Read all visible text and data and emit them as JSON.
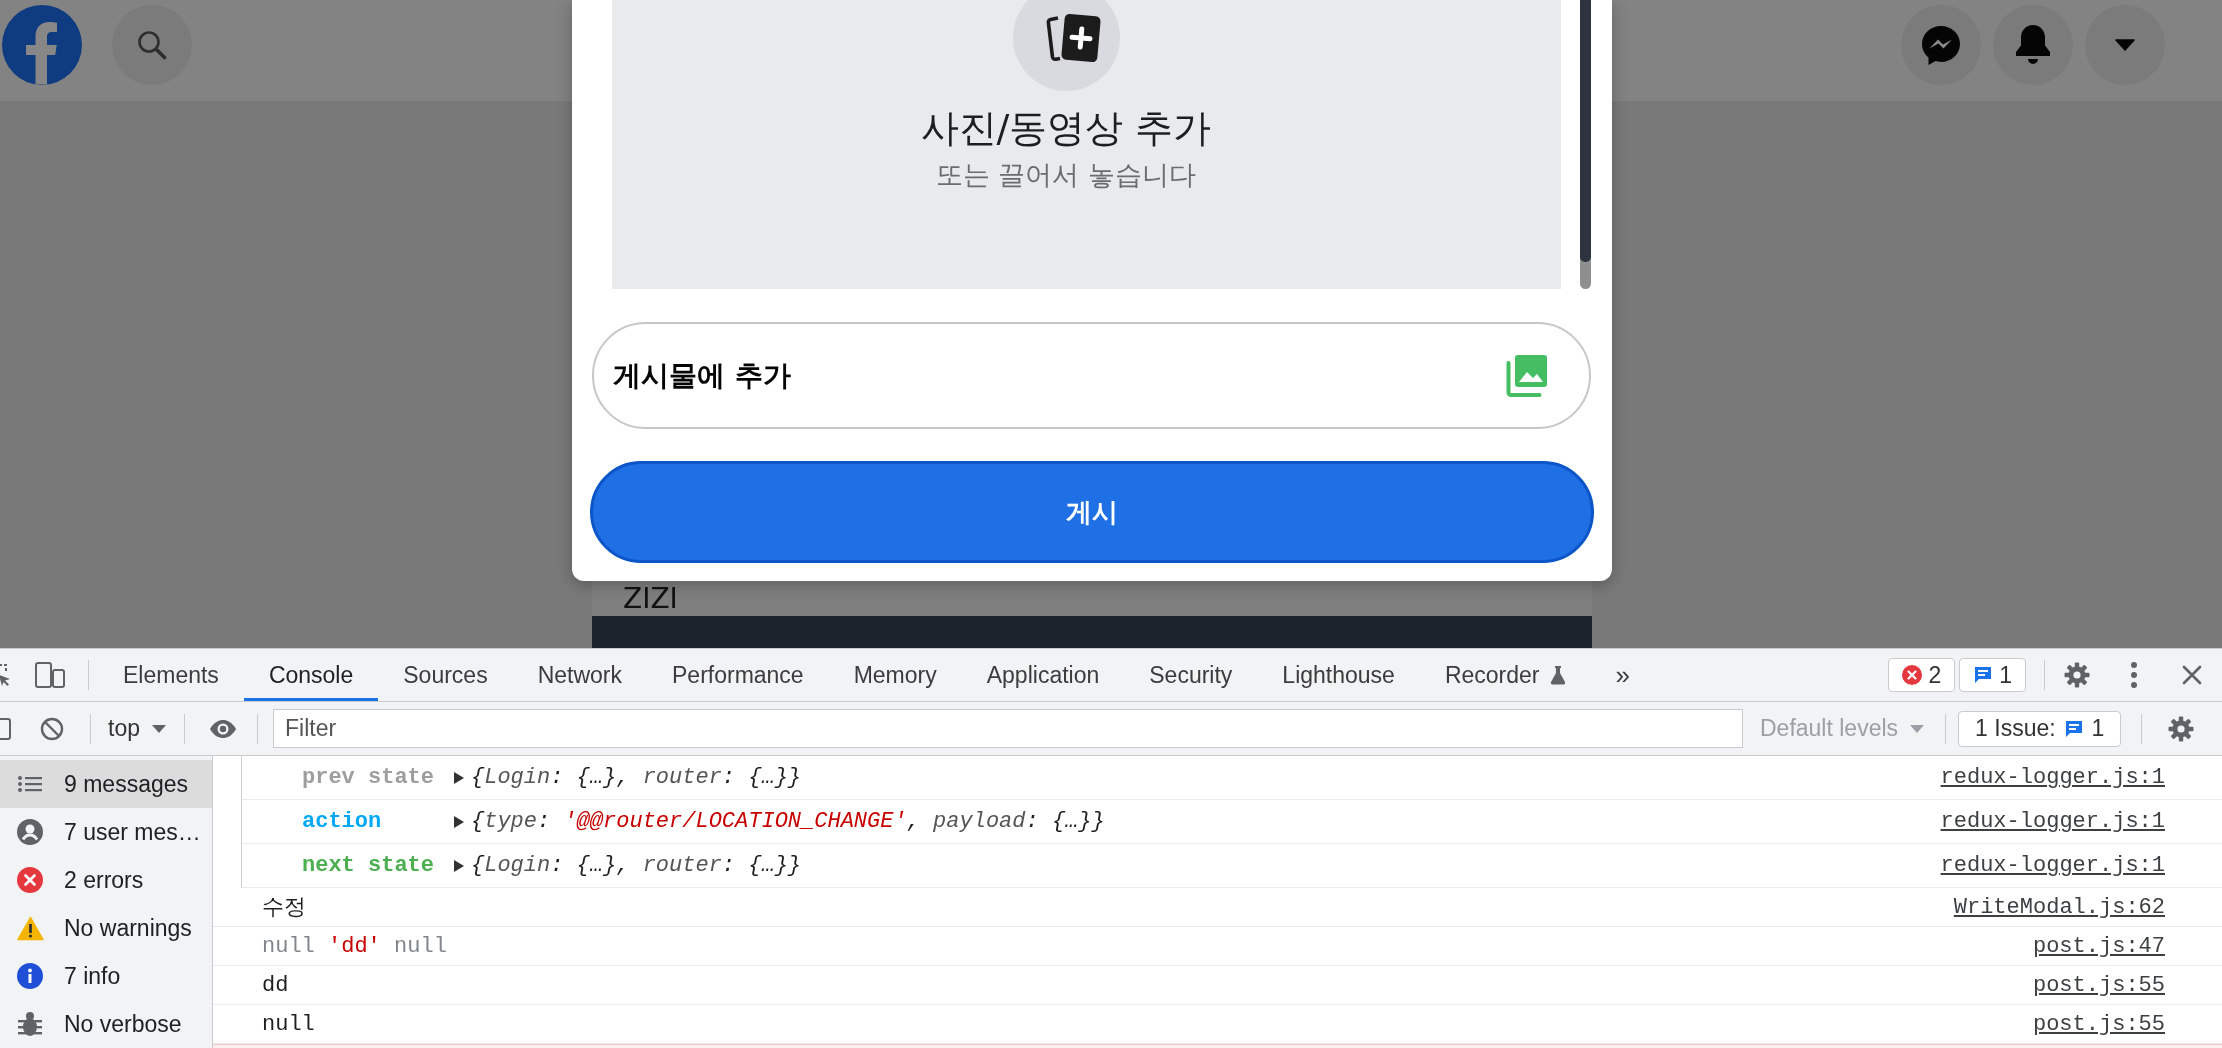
{
  "modal": {
    "upload_title": "사진/동영상 추가",
    "upload_hint": "또는 끌어서 놓습니다",
    "add_to_post": "게시물에 추가",
    "post_button": "게시"
  },
  "background_post": {
    "text": "ZIZI"
  },
  "devtools": {
    "tabs": [
      {
        "label": "Elements",
        "kind": "plain",
        "selected": false
      },
      {
        "label": "Console",
        "kind": "plain",
        "selected": true
      },
      {
        "label": "Sources",
        "kind": "plain",
        "selected": false
      },
      {
        "label": "Network",
        "kind": "plain",
        "selected": false
      },
      {
        "label": "Performance",
        "kind": "plain",
        "selected": false
      },
      {
        "label": "Memory",
        "kind": "plain",
        "selected": false
      },
      {
        "label": "Application",
        "kind": "plain",
        "selected": false
      },
      {
        "label": "Security",
        "kind": "plain",
        "selected": false
      },
      {
        "label": "Lighthouse",
        "kind": "plain",
        "selected": false
      },
      {
        "label": "Recorder",
        "kind": "experimental",
        "selected": false
      }
    ],
    "more_tabs": "»",
    "error_badge": "2",
    "message_badge": "1",
    "toolbar": {
      "context": "top",
      "filter": {
        "placeholder": "Filter"
      },
      "levels": {
        "label": "Default levels",
        "disabled": true
      },
      "issues": {
        "label": "1 Issue:",
        "count": "1"
      }
    },
    "sidebar": {
      "items": [
        {
          "kind": "all",
          "label": "9 messages",
          "selected": true
        },
        {
          "kind": "user",
          "label": "7 user mes…",
          "selected": false
        },
        {
          "kind": "error",
          "label": "2 errors",
          "selected": false
        },
        {
          "kind": "warning",
          "label": "No warnings",
          "selected": false
        },
        {
          "kind": "info",
          "label": "7 info",
          "selected": false
        },
        {
          "kind": "verbose",
          "label": "No verbose",
          "selected": false
        }
      ]
    },
    "console": {
      "group": [
        {
          "label": "prev state",
          "color": "#9e9e9e",
          "expanded": false,
          "preview": [
            {
              "kind": "plain",
              "text": "{"
            },
            {
              "kind": "key",
              "text": "Login"
            },
            {
              "kind": "plain",
              "text": ": {…}, "
            },
            {
              "kind": "key",
              "text": "router"
            },
            {
              "kind": "plain",
              "text": ": {…}}"
            }
          ],
          "source": "redux-logger.js:1"
        },
        {
          "label": "action",
          "color": "#03a9f4",
          "expanded": false,
          "preview": [
            {
              "kind": "plain",
              "text": "{"
            },
            {
              "kind": "key",
              "text": "type"
            },
            {
              "kind": "plain",
              "text": ": "
            },
            {
              "kind": "string",
              "text": "'@@router/LOCATION_CHANGE'"
            },
            {
              "kind": "plain",
              "text": ", "
            },
            {
              "kind": "key",
              "text": "payload"
            },
            {
              "kind": "plain",
              "text": ": {…}}"
            }
          ],
          "source": "redux-logger.js:1"
        },
        {
          "label": "next state",
          "color": "#4caf50",
          "expanded": false,
          "preview": [
            {
              "kind": "plain",
              "text": "{"
            },
            {
              "kind": "key",
              "text": "Login"
            },
            {
              "kind": "plain",
              "text": ": {…}, "
            },
            {
              "kind": "key",
              "text": "router"
            },
            {
              "kind": "plain",
              "text": ": {…}}"
            }
          ],
          "source": "redux-logger.js:1"
        }
      ],
      "messages": [
        {
          "kind": "log",
          "parts": [
            {
              "kind": "plain",
              "text": "수정"
            }
          ],
          "source": "WriteModal.js:62"
        },
        {
          "kind": "log",
          "parts": [
            {
              "kind": "null",
              "text": "null "
            },
            {
              "kind": "string",
              "text": "'dd'"
            },
            {
              "kind": "null",
              "text": " null"
            }
          ],
          "source": "post.js:47"
        },
        {
          "kind": "log",
          "parts": [
            {
              "kind": "plain",
              "text": "dd"
            }
          ],
          "source": "post.js:55"
        },
        {
          "kind": "log",
          "parts": [
            {
              "kind": "plain",
              "text": "null"
            }
          ],
          "source": "post.js:55"
        },
        {
          "kind": "error"
        }
      ]
    }
  }
}
